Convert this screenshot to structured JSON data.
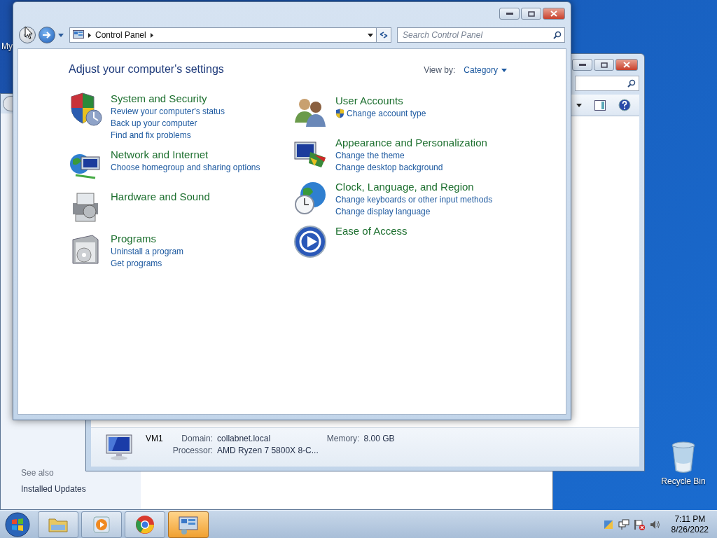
{
  "desktop": {
    "icons": [
      {
        "kind": "computer",
        "label": "My"
      },
      {
        "kind": "recycle",
        "label": "Recycle Bin"
      }
    ]
  },
  "back_window": {
    "see_also": "See also",
    "links": [
      "Installed Updates"
    ]
  },
  "system_window": {
    "details": {
      "name": "VM1",
      "fields": [
        {
          "label": "Domain:",
          "value": "collabnet.local"
        },
        {
          "label": "Memory:",
          "value": "8.00 GB"
        },
        {
          "label": "Processor:",
          "value": "AMD Ryzen 7 5800X 8-C..."
        }
      ]
    }
  },
  "control_panel": {
    "navigation": [
      {
        "kind": "back",
        "disabled": true
      },
      {
        "kind": "forward",
        "disabled": false
      }
    ],
    "breadcrumb": [
      "Control Panel"
    ],
    "search": {
      "placeholder": "Search Control Panel"
    },
    "heading": "Adjust your computer's settings",
    "view_by": {
      "label": "View by:",
      "value": "Category"
    },
    "columns": [
      [
        {
          "kind": "security",
          "title": "System and Security",
          "links": [
            {
              "text": "Review your computer's status",
              "shield": false
            },
            {
              "text": "Back up your computer",
              "shield": false
            },
            {
              "text": "Find and fix problems",
              "shield": false
            }
          ]
        },
        {
          "kind": "network",
          "title": "Network and Internet",
          "links": [
            {
              "text": "Choose homegroup and sharing options",
              "shield": false
            }
          ]
        },
        {
          "kind": "hardware",
          "title": "Hardware and Sound"
        },
        {
          "kind": "programs",
          "title": "Programs",
          "links": [
            {
              "text": "Uninstall a program",
              "shield": false
            },
            {
              "text": "Get programs",
              "shield": false
            }
          ]
        }
      ],
      [
        {
          "kind": "users",
          "title": "User Accounts",
          "links": [
            {
              "text": "Change account type",
              "shield": true
            }
          ]
        },
        {
          "kind": "appearance",
          "title": "Appearance and Personalization",
          "links": [
            {
              "text": "Change the theme",
              "shield": false
            },
            {
              "text": "Change desktop background",
              "shield": false
            }
          ]
        },
        {
          "kind": "clock",
          "title": "Clock, Language, and Region",
          "links": [
            {
              "text": "Change keyboards or other input methods",
              "shield": false
            },
            {
              "text": "Change display language",
              "shield": false
            }
          ]
        },
        {
          "kind": "access",
          "title": "Ease of Access"
        }
      ]
    ]
  },
  "taskbar": {
    "buttons": [
      {
        "kind": "explorer",
        "selected": false
      },
      {
        "kind": "media",
        "selected": false
      },
      {
        "kind": "browser",
        "selected": false
      },
      {
        "kind": "control",
        "selected": true
      }
    ],
    "clock": {
      "time": "7:11 PM",
      "date": "8/26/2022"
    }
  }
}
